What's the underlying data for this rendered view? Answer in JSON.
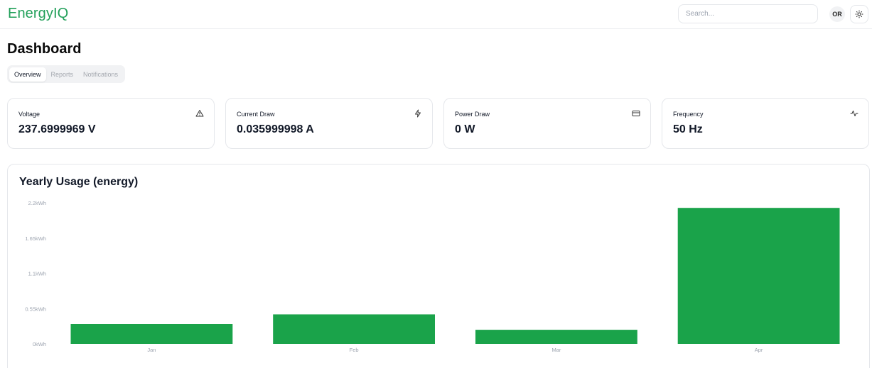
{
  "header": {
    "logo": "EnergyIQ",
    "search_placeholder": "Search...",
    "avatar_initials": "OR",
    "theme_icon": "sun-icon"
  },
  "page": {
    "title": "Dashboard",
    "tabs": [
      {
        "label": "Overview",
        "active": true
      },
      {
        "label": "Reports",
        "active": false
      },
      {
        "label": "Notifications",
        "active": false
      }
    ]
  },
  "cards": [
    {
      "label": "Voltage",
      "value": "237.6999969 V",
      "icon": "warning-triangle-icon"
    },
    {
      "label": "Current Draw",
      "value": "0.035999998 A",
      "icon": "lightning-icon"
    },
    {
      "label": "Power Draw",
      "value": "0 W",
      "icon": "card-icon"
    },
    {
      "label": "Frequency",
      "value": "50 Hz",
      "icon": "activity-pulse-icon"
    }
  ],
  "chart": {
    "title": "Yearly Usage (energy)"
  },
  "colors": {
    "brand": "#22a05a",
    "bar": "#1aa34a"
  },
  "chart_data": {
    "type": "bar",
    "title": "Yearly Usage (energy)",
    "categories": [
      "Jan",
      "Feb",
      "Mar",
      "Apr"
    ],
    "values": [
      0.31,
      0.46,
      0.22,
      2.12
    ],
    "unit": "kWh",
    "ylim": [
      0,
      2.2
    ],
    "yticks": [
      0,
      0.55,
      1.1,
      1.65,
      2.2
    ],
    "ytick_labels": [
      "0kWh",
      "0.55kWh",
      "1.1kWh",
      "1.65kWh",
      "2.2kWh"
    ],
    "grid": false,
    "legend": "none"
  }
}
